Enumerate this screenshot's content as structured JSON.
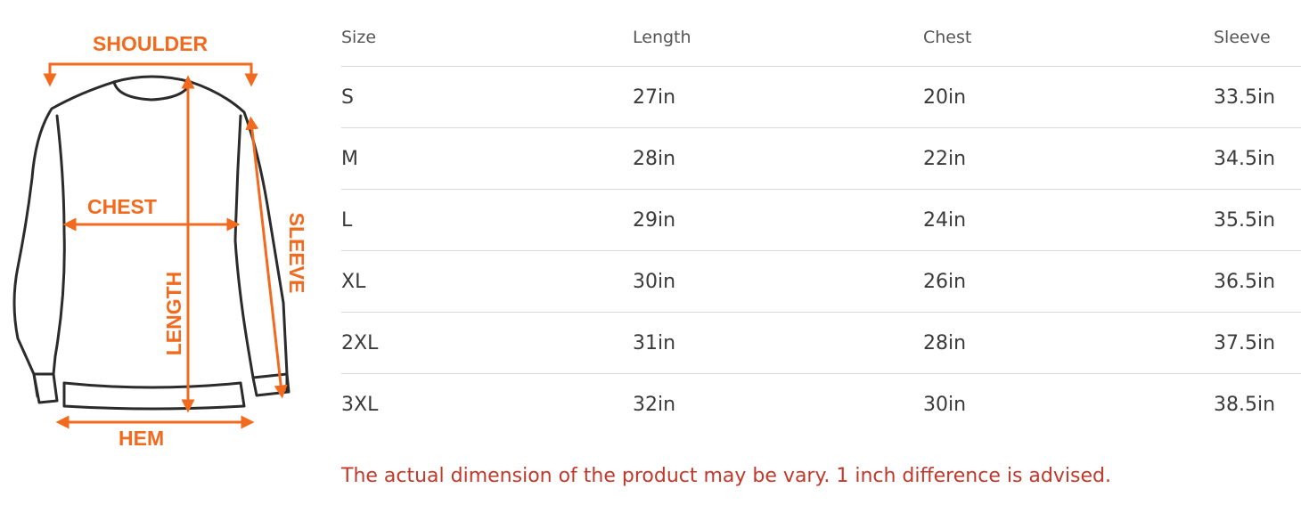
{
  "diagram": {
    "labels": {
      "shoulder": "SHOULDER",
      "chest": "CHEST",
      "length": "LENGTH",
      "sleeve": "SLEEVE",
      "hem": "HEM"
    },
    "accent_color": "#f26a1e",
    "outline_color": "#2b2b2b"
  },
  "size_table": {
    "headers": [
      "Size",
      "Length",
      "Chest",
      "Sleeve"
    ],
    "rows": [
      [
        "S",
        "27in",
        "20in",
        "33.5in"
      ],
      [
        "M",
        "28in",
        "22in",
        "34.5in"
      ],
      [
        "L",
        "29in",
        "24in",
        "35.5in"
      ],
      [
        "XL",
        "30in",
        "26in",
        "36.5in"
      ],
      [
        "2XL",
        "31in",
        "28in",
        "37.5in"
      ],
      [
        "3XL",
        "32in",
        "30in",
        "38.5in"
      ]
    ]
  },
  "note": "The actual dimension of the product may be vary. 1 inch difference is advised.",
  "note_color": "#c0392b"
}
